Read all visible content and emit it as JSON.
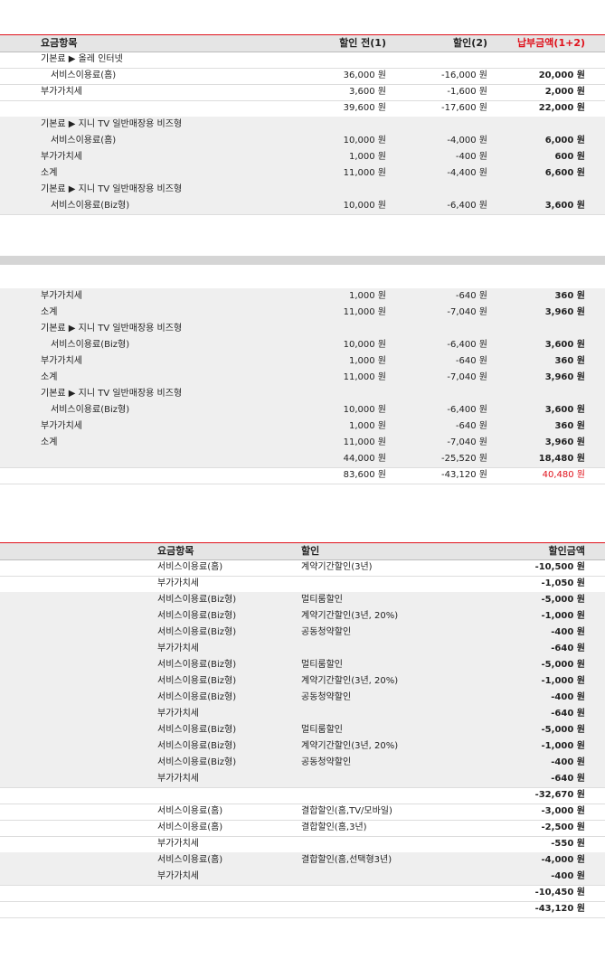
{
  "table1": {
    "headers": [
      "요금항목",
      "할인 전(1)",
      "할인(2)",
      "납부금액(1+2)"
    ],
    "rows_a": [
      {
        "label": "기본료  ▶ 올레 인터넷",
        "indent": false,
        "v1": "",
        "v2": "",
        "v3": "",
        "shaded": false
      },
      {
        "label": "서비스이용료(홈)",
        "indent": true,
        "v1": "36,000 원",
        "v2": "-16,000 원",
        "v3": "20,000 원",
        "shaded": false
      },
      {
        "label": "부가가치세",
        "indent": false,
        "v1": "3,600 원",
        "v2": "-1,600 원",
        "v3": "2,000 원",
        "shaded": false
      },
      {
        "label": "",
        "indent": false,
        "v1": "39,600 원",
        "v2": "-17,600 원",
        "v3": "22,000 원",
        "shaded": false
      },
      {
        "label": "기본료  ▶ 지니 TV 일반매장용 비즈형",
        "indent": false,
        "v1": "",
        "v2": "",
        "v3": "",
        "shaded": true
      },
      {
        "label": "서비스이용료(홈)",
        "indent": true,
        "v1": "10,000 원",
        "v2": "-4,000 원",
        "v3": "6,000 원",
        "shaded": true
      },
      {
        "label": "부가가치세",
        "indent": false,
        "v1": "1,000 원",
        "v2": "-400 원",
        "v3": "600 원",
        "shaded": true
      },
      {
        "label": "소계",
        "indent": false,
        "v1": "11,000 원",
        "v2": "-4,400 원",
        "v3": "6,600 원",
        "shaded": true
      },
      {
        "label": "기본료  ▶ 지니 TV 일반매장용 비즈형",
        "indent": false,
        "v1": "",
        "v2": "",
        "v3": "",
        "shaded": true
      },
      {
        "label": "서비스이용료(Biz형)",
        "indent": true,
        "v1": "10,000 원",
        "v2": "-6,400 원",
        "v3": "3,600 원",
        "shaded": true
      }
    ],
    "rows_b": [
      {
        "label": "부가가치세",
        "indent": false,
        "v1": "1,000 원",
        "v2": "-640 원",
        "v3": "360 원",
        "shaded": true
      },
      {
        "label": "소계",
        "indent": false,
        "v1": "11,000 원",
        "v2": "-7,040 원",
        "v3": "3,960 원",
        "shaded": true
      },
      {
        "label": "기본료  ▶ 지니 TV 일반매장용 비즈형",
        "indent": false,
        "v1": "",
        "v2": "",
        "v3": "",
        "shaded": true
      },
      {
        "label": "서비스이용료(Biz형)",
        "indent": true,
        "v1": "10,000 원",
        "v2": "-6,400 원",
        "v3": "3,600 원",
        "shaded": true
      },
      {
        "label": "부가가치세",
        "indent": false,
        "v1": "1,000 원",
        "v2": "-640 원",
        "v3": "360 원",
        "shaded": true
      },
      {
        "label": "소계",
        "indent": false,
        "v1": "11,000 원",
        "v2": "-7,040 원",
        "v3": "3,960 원",
        "shaded": true
      },
      {
        "label": "기본료  ▶ 지니 TV 일반매장용 비즈형",
        "indent": false,
        "v1": "",
        "v2": "",
        "v3": "",
        "shaded": true
      },
      {
        "label": "서비스이용료(Biz형)",
        "indent": true,
        "v1": "10,000 원",
        "v2": "-6,400 원",
        "v3": "3,600 원",
        "shaded": true
      },
      {
        "label": "부가가치세",
        "indent": false,
        "v1": "1,000 원",
        "v2": "-640 원",
        "v3": "360 원",
        "shaded": true
      },
      {
        "label": "소계",
        "indent": false,
        "v1": "11,000 원",
        "v2": "-7,040 원",
        "v3": "3,960 원",
        "shaded": true
      },
      {
        "label": "",
        "indent": false,
        "v1": "44,000 원",
        "v2": "-25,520 원",
        "v3": "18,480 원",
        "shaded": true
      },
      {
        "label": "",
        "indent": false,
        "v1": "83,600 원",
        "v2": "-43,120 원",
        "v3": "40,480 원",
        "shaded": false,
        "red": true
      }
    ]
  },
  "table2": {
    "headers": [
      "요금항목",
      "할인",
      "할인금액"
    ],
    "rows": [
      {
        "item": "서비스이용료(홈)",
        "disc": "계약기간할인(3년)",
        "amt": "-10,500 원",
        "shaded": false
      },
      {
        "item": "부가가치세",
        "disc": "",
        "amt": "-1,050 원",
        "shaded": false
      },
      {
        "item": "서비스이용료(Biz형)",
        "disc": "멀티룸할인",
        "amt": "-5,000 원",
        "shaded": true
      },
      {
        "item": "서비스이용료(Biz형)",
        "disc": "계약기간할인(3년, 20%)",
        "amt": "-1,000 원",
        "shaded": true
      },
      {
        "item": "서비스이용료(Biz형)",
        "disc": "공동청약할인",
        "amt": "-400 원",
        "shaded": true
      },
      {
        "item": "부가가치세",
        "disc": "",
        "amt": "-640 원",
        "shaded": true
      },
      {
        "item": "서비스이용료(Biz형)",
        "disc": "멀티룸할인",
        "amt": "-5,000 원",
        "shaded": true
      },
      {
        "item": "서비스이용료(Biz형)",
        "disc": "계약기간할인(3년, 20%)",
        "amt": "-1,000 원",
        "shaded": true
      },
      {
        "item": "서비스이용료(Biz형)",
        "disc": "공동청약할인",
        "amt": "-400 원",
        "shaded": true
      },
      {
        "item": "부가가치세",
        "disc": "",
        "amt": "-640 원",
        "shaded": true
      },
      {
        "item": "서비스이용료(Biz형)",
        "disc": "멀티룸할인",
        "amt": "-5,000 원",
        "shaded": true
      },
      {
        "item": "서비스이용료(Biz형)",
        "disc": "계약기간할인(3년, 20%)",
        "amt": "-1,000 원",
        "shaded": true
      },
      {
        "item": "서비스이용료(Biz형)",
        "disc": "공동청약할인",
        "amt": "-400 원",
        "shaded": true
      },
      {
        "item": "부가가치세",
        "disc": "",
        "amt": "-640 원",
        "shaded": true
      },
      {
        "item": "",
        "disc": "",
        "amt": "-32,670 원",
        "shaded": false
      },
      {
        "item": "서비스이용료(홈)",
        "disc": "결합할인(홈,TV/모바일)",
        "amt": "-3,000 원",
        "shaded": false
      },
      {
        "item": "서비스이용료(홈)",
        "disc": "결합할인(홈,3년)",
        "amt": "-2,500 원",
        "shaded": false
      },
      {
        "item": "부가가치세",
        "disc": "",
        "amt": "-550 원",
        "shaded": false
      },
      {
        "item": "서비스이용료(홈)",
        "disc": "결합할인(홈,선택형3년)",
        "amt": "-4,000 원",
        "shaded": true
      },
      {
        "item": "부가가치세",
        "disc": "",
        "amt": "-400 원",
        "shaded": true
      },
      {
        "item": "",
        "disc": "",
        "amt": "-10,450 원",
        "shaded": false
      },
      {
        "item": "",
        "disc": "",
        "amt": "-43,120 원",
        "shaded": false
      }
    ]
  },
  "colors": {
    "accent": "#e0111b",
    "header_bg": "#e5e5e5",
    "row_shade": "#efefef"
  }
}
